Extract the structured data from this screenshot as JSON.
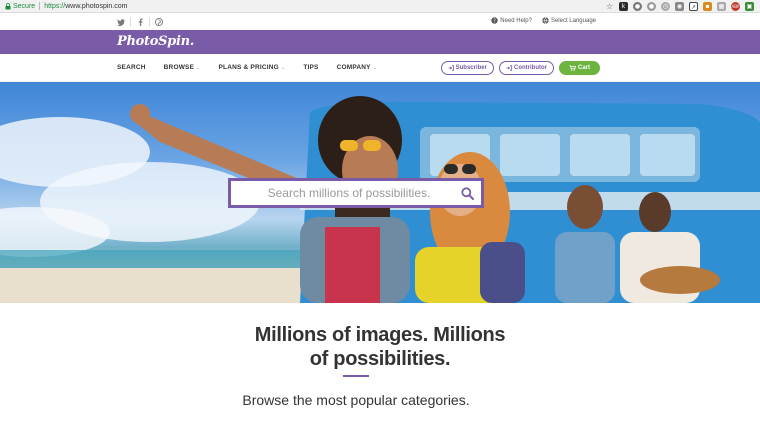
{
  "browser": {
    "secure_label": "Secure",
    "url_scheme": "https://",
    "url_host": "www.photospin.com"
  },
  "util": {
    "help_label": "Need Help?",
    "language_label": "Select Language"
  },
  "brand": {
    "logo_text": "PhotoSpin.",
    "accent_color": "#7a5ba8",
    "cart_color": "#6cb33f"
  },
  "nav": {
    "items": [
      {
        "label": "SEARCH"
      },
      {
        "label": "BROWSE"
      },
      {
        "label": "PLANS & PRICING"
      },
      {
        "label": "TIPS"
      },
      {
        "label": "COMPANY"
      }
    ],
    "subscriber_label": "Subscriber",
    "contributor_label": "Contributor",
    "cart_label": "Cart"
  },
  "hero": {
    "search_placeholder": "Search millions of possibilities."
  },
  "content": {
    "headline_line1": "Millions of images. Millions",
    "headline_line2": "of possibilities.",
    "subheading": "Browse the most popular categories."
  }
}
